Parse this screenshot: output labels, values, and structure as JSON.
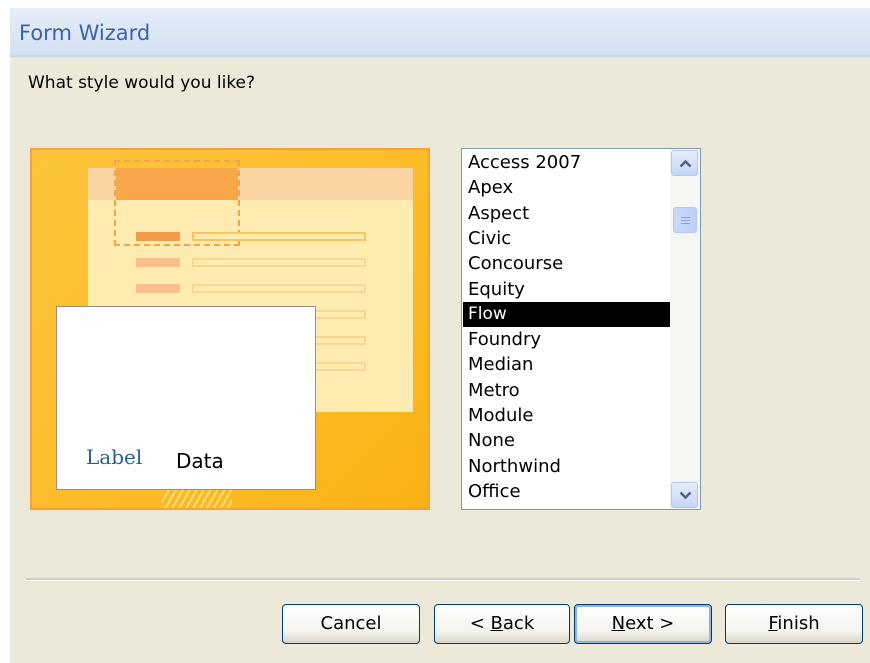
{
  "window": {
    "title": "Form Wizard"
  },
  "question": "What style would you like?",
  "preview": {
    "label_text": "Label",
    "data_text": "Data"
  },
  "styles": {
    "items": [
      "Access 2007",
      "Apex",
      "Aspect",
      "Civic",
      "Concourse",
      "Equity",
      "Flow",
      "Foundry",
      "Median",
      "Metro",
      "Module",
      "None",
      "Northwind",
      "Office"
    ],
    "selected": "Flow"
  },
  "buttons": {
    "cancel": "Cancel",
    "back": {
      "prefix": "< ",
      "accel": "B",
      "rest": "ack"
    },
    "next": {
      "accel": "N",
      "rest": "ext >"
    },
    "finish": {
      "accel": "F",
      "rest": "inish"
    }
  },
  "icons": {
    "scroll_up": "chevron-up-icon",
    "scroll_down": "chevron-down-icon"
  }
}
